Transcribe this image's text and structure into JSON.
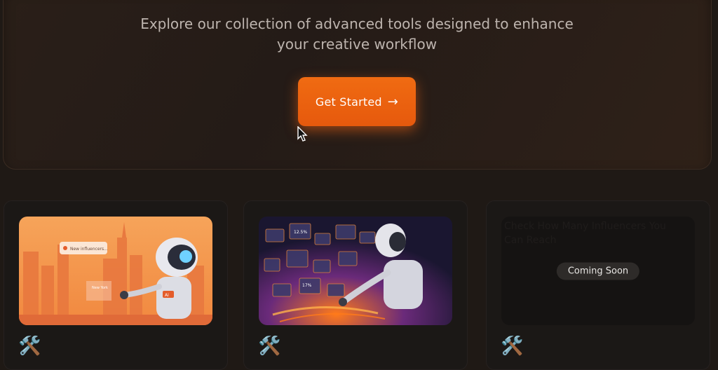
{
  "hero": {
    "subtitle_line1": "Explore our collection of advanced tools designed to enhance",
    "subtitle_line2": "your creative workflow",
    "cta_label": "Get Started",
    "cta_arrow": "→",
    "accent_color": "#f06b12"
  },
  "cards": [
    {
      "thumb_search_text": "New influencers...",
      "thumb_city_text": "New York",
      "robot_badge_text": "Ai",
      "tool_icon": "hammer-and-wrench-icon"
    },
    {
      "floating_label_a": "12.5%",
      "floating_label_b": "17%",
      "tool_icon": "hammer-and-wrench-icon"
    },
    {
      "ghost_text": "Check How Many Influencers You Can Reach",
      "badge": "Coming Soon",
      "tool_icon": "hammer-and-wrench-icon"
    }
  ]
}
